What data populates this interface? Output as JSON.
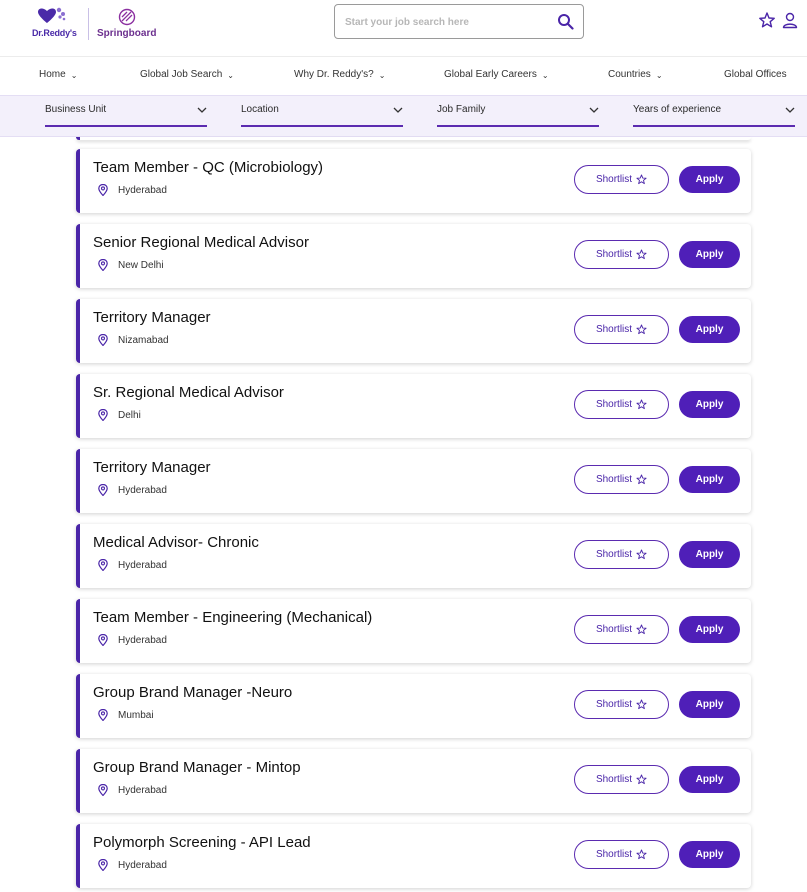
{
  "brand": {
    "logo_text": "Dr.Reddy's",
    "sub_brand": "Springboard",
    "accent_color": "#4f1fb8"
  },
  "search": {
    "placeholder": "Start your job search here",
    "value": "",
    "icon": "search-icon"
  },
  "header_icons": [
    "star-icon",
    "user-icon"
  ],
  "nav": {
    "items": [
      {
        "label": "Home",
        "has_dropdown": true
      },
      {
        "label": "Global Job Search",
        "has_dropdown": true
      },
      {
        "label": "Why Dr. Reddy's?",
        "has_dropdown": true
      },
      {
        "label": "Global Early Careers",
        "has_dropdown": true
      },
      {
        "label": "Countries",
        "has_dropdown": true
      },
      {
        "label": "Global Offices",
        "has_dropdown": false
      }
    ]
  },
  "filters": [
    {
      "label": "Business Unit"
    },
    {
      "label": "Location"
    },
    {
      "label": "Job Family"
    },
    {
      "label": "Years of experience"
    }
  ],
  "actions": {
    "shortlist_label": "Shortlist",
    "apply_label": "Apply"
  },
  "jobs": [
    {
      "title": "Team Member - QC (Microbiology)",
      "location": "Hyderabad"
    },
    {
      "title": "Senior Regional Medical Advisor",
      "location": "New Delhi"
    },
    {
      "title": "Territory Manager",
      "location": "Nizamabad"
    },
    {
      "title": "Sr. Regional Medical Advisor",
      "location": "Delhi"
    },
    {
      "title": "Territory Manager",
      "location": "Hyderabad"
    },
    {
      "title": "Medical Advisor- Chronic",
      "location": "Hyderabad"
    },
    {
      "title": "Team Member - Engineering (Mechanical)",
      "location": "Hyderabad"
    },
    {
      "title": "Group Brand Manager -Neuro",
      "location": "Mumbai"
    },
    {
      "title": "Group Brand Manager - Mintop",
      "location": "Hyderabad"
    },
    {
      "title": "Polymorph Screening - API Lead",
      "location": "Hyderabad"
    }
  ]
}
